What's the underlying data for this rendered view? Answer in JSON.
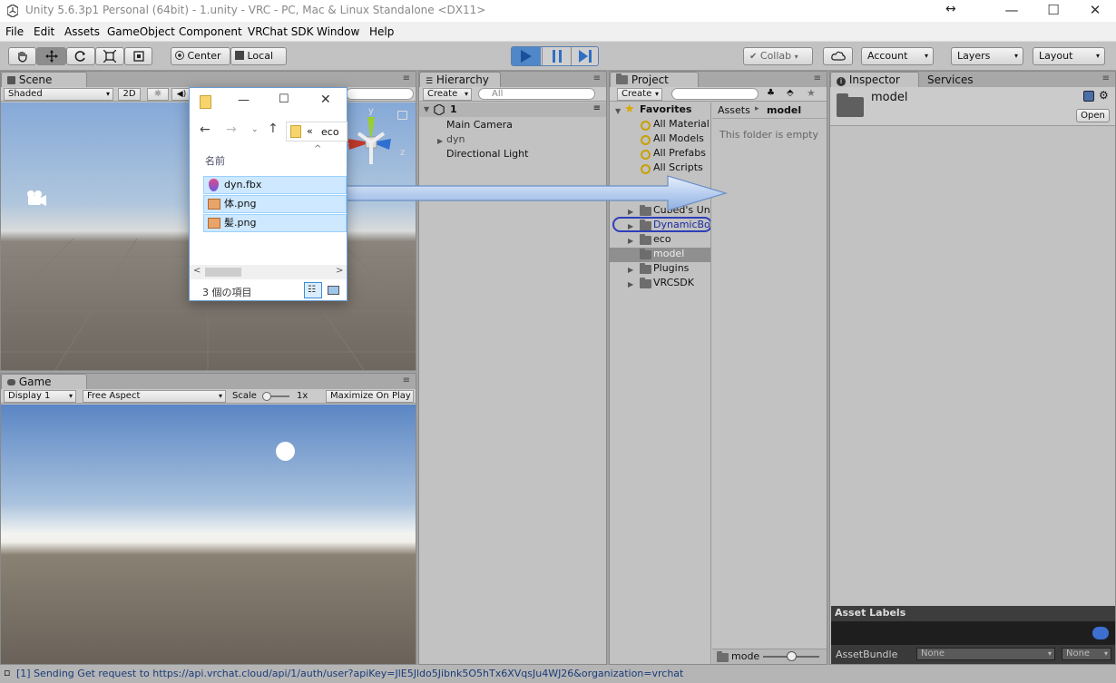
{
  "window": {
    "title": "Unity 5.6.3p1 Personal (64bit) - 1.unity - VRC - PC, Mac & Linux Standalone <DX11>",
    "resize_glyph": "↔",
    "minimize": "—",
    "maximize": "☐",
    "close": "✕"
  },
  "menu": [
    "File",
    "Edit",
    "Assets",
    "GameObject",
    "Component",
    "VRChat SDK",
    "Window",
    "Help"
  ],
  "toolbar": {
    "pivot_center": "Center",
    "pivot_local": "Local",
    "collab": "Collab",
    "account": "Account",
    "layers": "Layers",
    "layout": "Layout"
  },
  "scene": {
    "tab": "Scene",
    "shading": "Shaded",
    "mode_2d": "2D",
    "axis_y": "y",
    "axis_x": "x",
    "axis_z": "z"
  },
  "game": {
    "tab": "Game",
    "display": "Display 1",
    "aspect": "Free Aspect",
    "scale_label": "Scale",
    "scale_value": "1x",
    "maximize": "Maximize On Play"
  },
  "hierarchy": {
    "tab": "Hierarchy",
    "create": "Create",
    "search_placeholder": "All",
    "scene_name": "1",
    "items": [
      "Main Camera",
      "dyn",
      "Directional Light"
    ]
  },
  "project": {
    "tab": "Project",
    "create": "Create",
    "favorites_label": "Favorites",
    "favorites": [
      "All Material",
      "All Models",
      "All Prefabs",
      "All Scripts"
    ],
    "folders": [
      "Cubed's Un",
      "DynamicBo",
      "eco",
      "model",
      "Plugins",
      "VRCSDK"
    ],
    "breadcrumb_root": "Assets",
    "breadcrumb_sep": "▸",
    "breadcrumb_current": "model",
    "empty_message": "This folder is empty",
    "footer_path": "mode"
  },
  "inspector": {
    "tab": "Inspector",
    "services_tab": "Services",
    "asset_name": "model",
    "open_button": "Open",
    "asset_labels": "Asset Labels",
    "assetbundle_label": "AssetBundle",
    "assetbundle_value": "None",
    "variant_value": "None"
  },
  "explorer": {
    "path_prefix": "«",
    "path": "eco",
    "column_name": "名前",
    "files": [
      "dyn.fbx",
      "体.png",
      "髪.png"
    ],
    "item_count": "3 個の項目"
  },
  "status": {
    "message": "[1] Sending Get request to https://api.vrchat.cloud/api/1/auth/user?apiKey=JlE5Jldo5Jibnk5O5hTx6XVqsJu4WJ26&organization=vrchat"
  },
  "colors": {
    "play_active": "#4f87c9",
    "panel_bg": "#c2c2c2",
    "selection": "#cde8ff",
    "drag_arrow": "#b9cff0"
  }
}
